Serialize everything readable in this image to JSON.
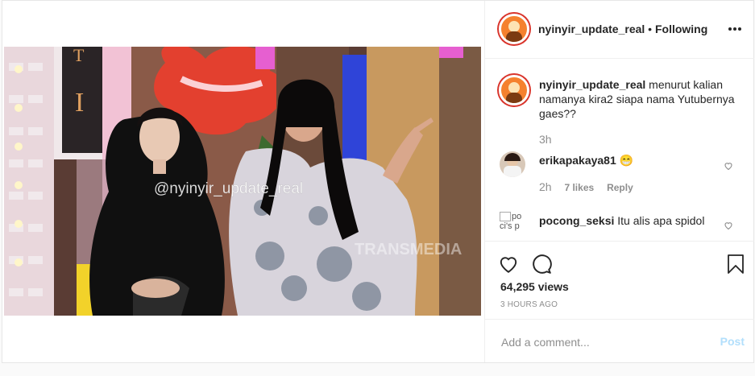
{
  "header": {
    "username": "nyinyir_update_real",
    "separator": "•",
    "follow_status": "Following",
    "more_icon": "more-icon"
  },
  "video": {
    "watermark": "@nyinyir_update_real",
    "channel_logo": "TRANSMEDIA",
    "sign_letter_1": "T",
    "sign_letter_2": "I"
  },
  "caption": {
    "username": "nyinyir_update_real",
    "text_line1": "menurut kalian",
    "text_line2": "namanya kira2 siapa nama Yutubernya",
    "text_line3": "gaes??",
    "time": "3h"
  },
  "comments": [
    {
      "username": "erikapakaya81",
      "emoji": "😁",
      "time": "2h",
      "likes": "7 likes",
      "reply": "Reply"
    },
    {
      "username": "pocong_seksi",
      "text": "Itu alis apa spidol",
      "avatar_alt": "pocong_seksi's profile picture",
      "avatar_alt_line1": "po",
      "avatar_alt_line2": "ci's p"
    }
  ],
  "actions": {
    "views": "64,295 views",
    "timestamp": "3 HOURS AGO"
  },
  "add_comment": {
    "placeholder": "Add a comment...",
    "post_label": "Post"
  },
  "colors": {
    "link_blue": "#b2dffc",
    "accent_orange": "#f5812e",
    "ring_red": "#d9342b"
  }
}
